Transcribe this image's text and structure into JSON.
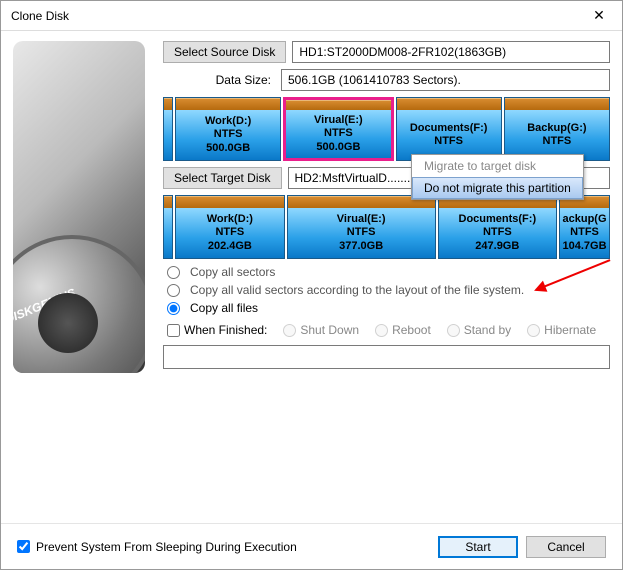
{
  "title": "Clone Disk",
  "sidebar_label": "DISKGENIUS",
  "source": {
    "button": "Select Source Disk",
    "value": "HD1:ST2000DM008-2FR102(1863GB)",
    "size_label": "Data Size:",
    "size_value": "506.1GB (1061410783 Sectors)."
  },
  "source_parts": [
    {
      "name": "Work(D:)",
      "fs": "NTFS",
      "size": "500.0GB"
    },
    {
      "name": "Virual(E:)",
      "fs": "NTFS",
      "size": "500.0GB",
      "selected": true
    },
    {
      "name": "Documents(F:)",
      "fs": "NTFS",
      "size": ""
    },
    {
      "name": "Backup(G:)",
      "fs": "NTFS",
      "size": ""
    }
  ],
  "context_menu": {
    "item1": "Migrate to target disk",
    "item2": "Do not migrate this partition"
  },
  "target": {
    "button": "Select Target Disk",
    "value": "HD2:MsftVirtualD........."
  },
  "target_parts": [
    {
      "name": "Work(D:)",
      "fs": "NTFS",
      "size": "202.4GB"
    },
    {
      "name": "Virual(E:)",
      "fs": "NTFS",
      "size": "377.0GB"
    },
    {
      "name": "Documents(F:)",
      "fs": "NTFS",
      "size": "247.9GB"
    },
    {
      "name": "ackup(G",
      "fs": "NTFS",
      "size": "104.7GB"
    }
  ],
  "copy_options": {
    "all_sectors": "Copy all sectors",
    "valid_sectors": "Copy all valid sectors according to the layout of the file system.",
    "all_files": "Copy all files"
  },
  "finish": {
    "label": "When Finished:",
    "shutdown": "Shut Down",
    "reboot": "Reboot",
    "standby": "Stand by",
    "hibernate": "Hibernate"
  },
  "footer": {
    "prevent_sleep": "Prevent System From Sleeping During Execution",
    "start": "Start",
    "cancel": "Cancel"
  }
}
